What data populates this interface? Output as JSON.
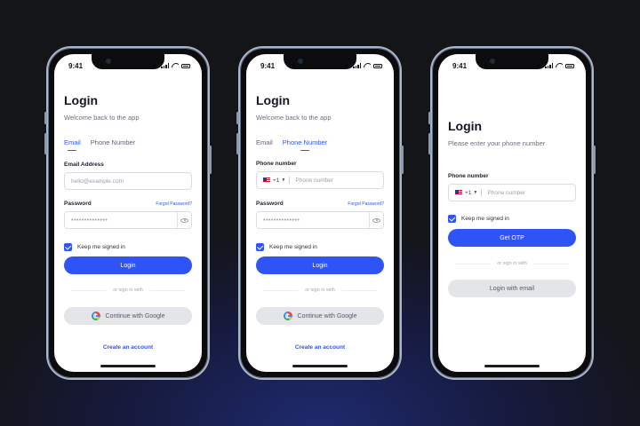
{
  "status_time": "9:41",
  "colors": {
    "accent": "#2f54f5",
    "secondary_button": "#e4e5e9",
    "background": "#141519"
  },
  "phone_email": {
    "title": "Login",
    "subtitle": "Welcome back to the app",
    "tabs": [
      "Email",
      "Phone Number"
    ],
    "active_tab": "Email",
    "email_label": "Email Address",
    "email_placeholder": "hello@example.com",
    "password_label": "Password",
    "password_value": "••••••••••••••",
    "forgot_label": "Forgot Password?",
    "keep_signed_in": "Keep me signed in",
    "login_button": "Login",
    "or_label": "or sign in with",
    "google_button": "Continue with Google",
    "create_account": "Create an account"
  },
  "phone_number_tab": {
    "title": "Login",
    "subtitle": "Welcome back to the app",
    "tabs": [
      "Email",
      "Phone Number"
    ],
    "active_tab": "Phone Number",
    "phone_label": "Phone number",
    "country_code": "+1",
    "phone_placeholder": "Phone number",
    "password_label": "Password",
    "password_value": "••••••••••••••",
    "forgot_label": "Forgot Password?",
    "keep_signed_in": "Keep me signed in",
    "login_button": "Login",
    "or_label": "or sign in with",
    "google_button": "Continue with Google",
    "create_account": "Create an account"
  },
  "phone_otp": {
    "title": "Login",
    "subtitle": "Please enter your phone number",
    "phone_label": "Phone number",
    "country_code": "+1",
    "phone_placeholder": "Phone number",
    "keep_signed_in": "Keep me signed in",
    "otp_button": "Get OTP",
    "or_label": "or sign in with",
    "email_button": "Login with email"
  }
}
